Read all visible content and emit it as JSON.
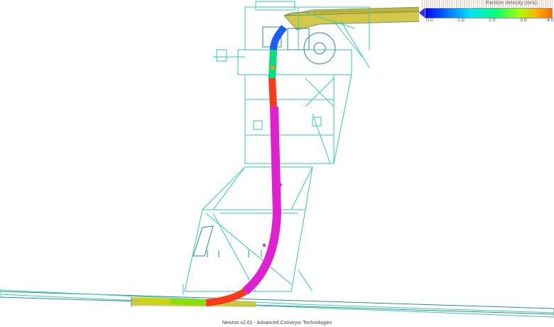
{
  "app": {
    "footer_text": "Newton v2.61 - Advanced Conveyor Technologies"
  },
  "legend": {
    "title": "Particle Velocity (m/s)",
    "ticks": [
      "0.0",
      "1.0",
      "2.0",
      "3.0",
      "4.0"
    ],
    "gradient_colors": [
      "#0a00ff",
      "#0090ff",
      "#00e0ff",
      "#00ff7a",
      "#a6ff00",
      "#ffb000",
      "#ff6a00"
    ]
  },
  "colors": {
    "structure_wireframe": "#39c6b8",
    "structure_wireframe_dark": "#2a8f86",
    "particles_fast": "#e020d0",
    "particles_mid": "#ff3a1a",
    "belt_yellow": "#c8c43a"
  }
}
